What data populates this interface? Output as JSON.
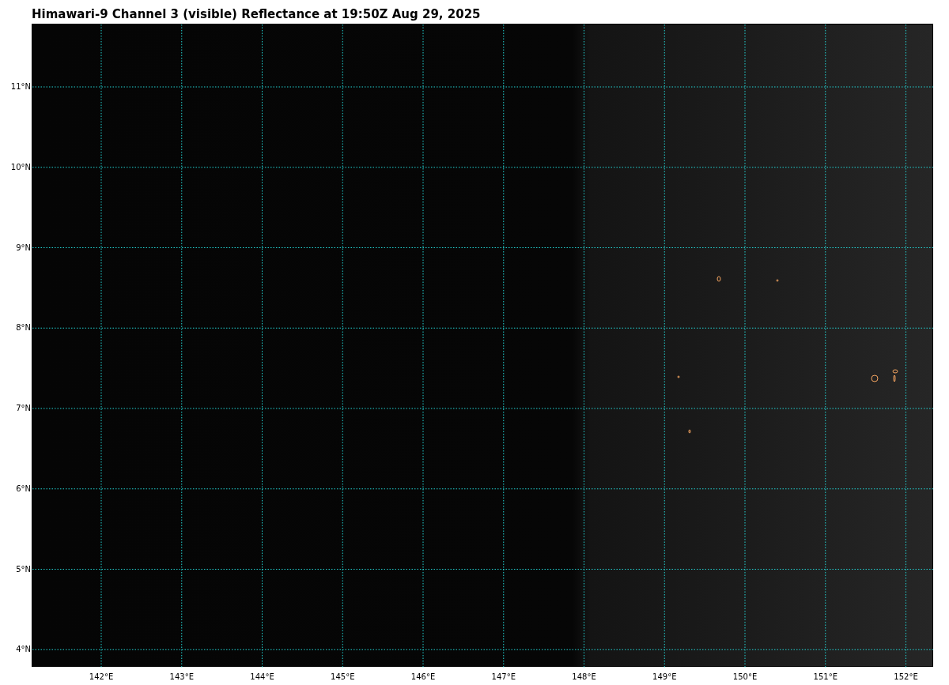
{
  "title": "Himawari-9 Channel 3 (visible) Reflectance at 19:50Z Aug 29, 2025",
  "map": {
    "longitude_labels": [
      "142°E",
      "143°E",
      "144°E",
      "145°E",
      "146°E",
      "147°E",
      "148°E",
      "149°E",
      "150°E",
      "151°E",
      "152°E"
    ],
    "latitude_labels": [
      "11°N",
      "10°N",
      "9°N",
      "8°N",
      "7°N",
      "6°N",
      "5°N",
      "4°N"
    ]
  }
}
